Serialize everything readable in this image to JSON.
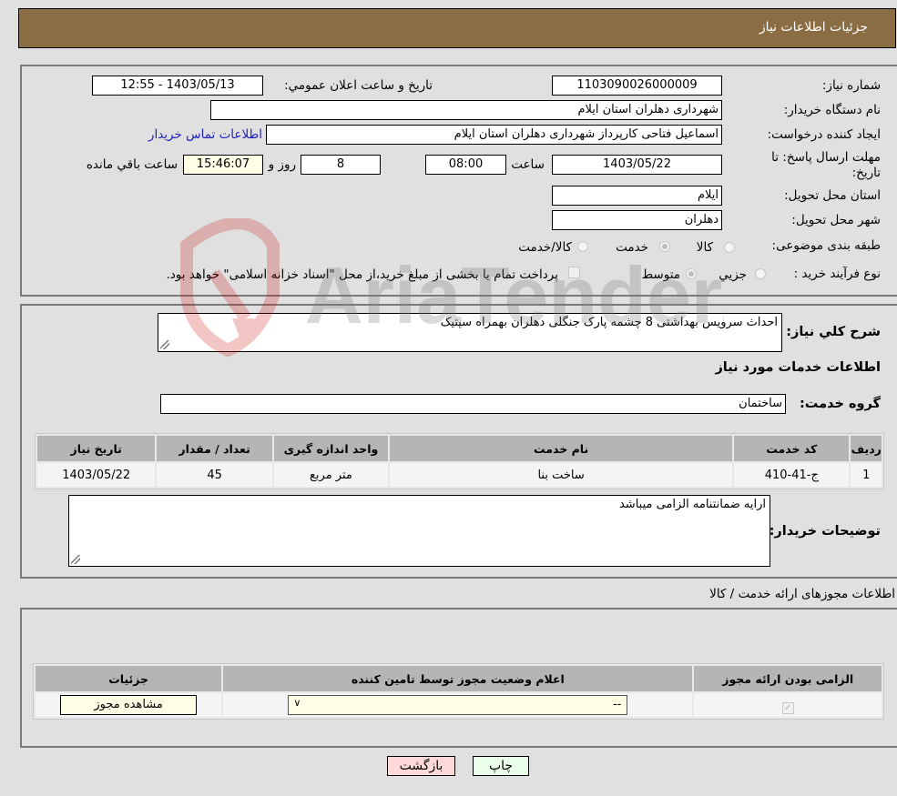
{
  "header": {
    "title": "جزئیات اطلاعات نیاز"
  },
  "info": {
    "need_number_label": "شماره نیاز:",
    "need_number": "1103090026000009",
    "announce_label": "تاریخ و ساعت اعلان عمومي:",
    "announce_value": "1403/05/13 - 12:55",
    "buyer_org_label": "نام دستگاه خریدار:",
    "buyer_org": "شهرداری دهلران استان ایلام",
    "creator_label": "ایجاد کننده درخواست:",
    "creator": "اسماعیل فتاحی کارپرداز شهرداری دهلران استان ایلام",
    "contact_link": "اطلاعات تماس خریدار",
    "deadline_label_line1": "مهلت ارسال پاسخ: تا",
    "deadline_label_line2": "تاریخ:",
    "deadline_date": "1403/05/22",
    "time_label": "ساعت",
    "deadline_time": "08:00",
    "days": "8",
    "days_label": "روز و",
    "remaining_time": "15:46:07",
    "remaining_label": "ساعت باقي مانده",
    "province_label": "استان محل تحویل:",
    "province": "ایلام",
    "city_label": "شهر محل تحویل:",
    "city": "دهلران",
    "category_label": "طبقه بندی موضوعی:",
    "category_options": [
      {
        "label": "کالا",
        "selected": false
      },
      {
        "label": "خدمت",
        "selected": true
      },
      {
        "label": "کالا/خدمت",
        "selected": false
      }
    ],
    "process_label": "نوع فرآیند خرید :",
    "process_options": [
      {
        "label": "جزيي",
        "selected": false
      },
      {
        "label": "متوسط",
        "selected": true
      }
    ],
    "treasury_checkbox_label": "پرداخت تمام یا بخشی از مبلغ خرید،از محل \"اسناد خزانه اسلامی\" خواهد بود.",
    "treasury_checked": false
  },
  "details": {
    "description_label": "شرح کلي نیاز:",
    "description": "احداث سرویس بهداشتی 8 چشمه پارک جنگلی دهلران بهمراه سپتیک",
    "services_heading": "اطلاعات خدمات مورد نیاز",
    "service_group_label": "گروه خدمت:",
    "service_group": "ساختمان",
    "table": {
      "headers": [
        "ردیف",
        "کد خدمت",
        "نام خدمت",
        "واحد اندازه گیری",
        "تعداد / مقدار",
        "تاریخ نیاز"
      ],
      "rows": [
        [
          "1",
          "ج-41-410",
          "ساخت بنا",
          "متر مربع",
          "45",
          "1403/05/22"
        ]
      ]
    },
    "buyer_notes_label": "توضیحات خریدار:",
    "buyer_notes": "ارایه ضمانتنامه الزامی میباشد"
  },
  "permits": {
    "heading": "اطلاعات مجوزهای ارائه خدمت / کالا",
    "headers": [
      "الزامی بودن ارائه مجوز",
      "اعلام وضعیت مجوز توسط تامین کننده",
      "جزئیات"
    ],
    "rows": [
      {
        "required": true,
        "status_value": "--",
        "details_button": "مشاهده مجوز"
      }
    ]
  },
  "buttons": {
    "print": "چاپ",
    "back": "بازگشت"
  },
  "watermark": {
    "text": "AriaTender.neT"
  }
}
